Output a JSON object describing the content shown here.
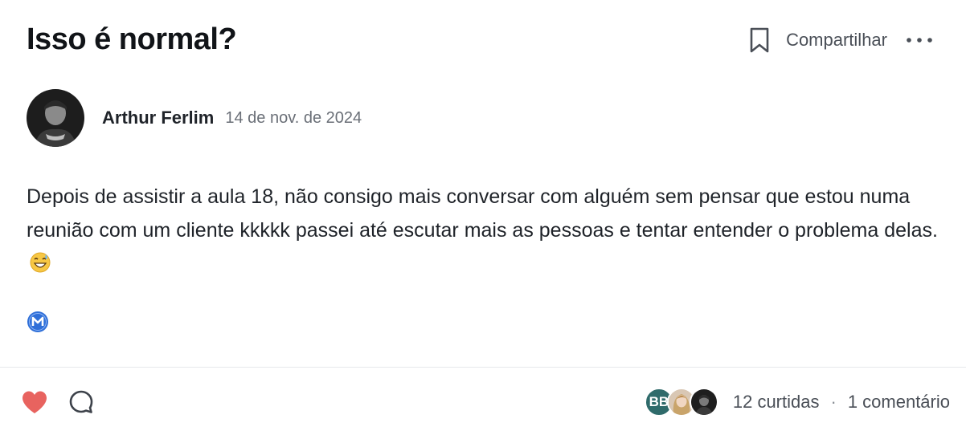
{
  "post": {
    "title": "Isso é normal?",
    "body": "Depois de assistir a aula 18, não consigo mais conversar com alguém sem pensar que estou numa reunião com um cliente kkkkk passei até escutar mais as pessoas e tentar entender o problema delas.",
    "emoji": "grinning-face-with-sweat"
  },
  "actions": {
    "share_label": "Compartilhar",
    "bookmark_icon": "bookmark-icon",
    "more_icon": "more-horizontal-icon"
  },
  "author": {
    "name": "Arthur Ferlim",
    "date": "14 de nov. de 2024",
    "badge_icon": "m-badge-icon",
    "badge_color": "#2f6fd8"
  },
  "footer": {
    "like_icon": "heart-icon",
    "like_color": "#e8635f",
    "comment_icon": "comment-icon",
    "likers": [
      {
        "initials": "BB",
        "color": "#2f6b6b"
      },
      {
        "avatar": "photo"
      },
      {
        "avatar": "photo"
      }
    ],
    "likes_text": "12 curtidas",
    "separator": "·",
    "comments_text": "1 comentário"
  }
}
